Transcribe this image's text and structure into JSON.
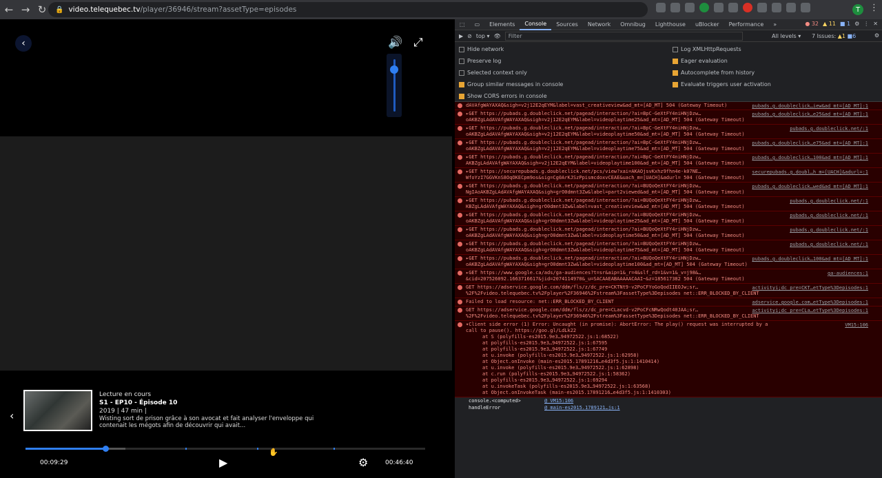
{
  "browser": {
    "url_host": "video.telequebec.tv",
    "url_path": "/player/36946/stream?assetType=episodes",
    "profile_initial": "T"
  },
  "player": {
    "now_playing_label": "Lecture en cours",
    "episode_title": "S1 - EP10 - Épisode 10",
    "episode_meta": "2019 | 47 min |",
    "episode_description": "Wisting sort de prison grâce à son avocat et fait analyser l'enveloppe qui contenait les mégots afin de découvrir qui avait...",
    "current_time": "00:09:29",
    "total_time": "00:46:40",
    "progress": 0.2,
    "buffered": 0.25,
    "volume": 0.8
  },
  "devtools": {
    "tabs": [
      "Elements",
      "Console",
      "Sources",
      "Network",
      "Omnibug",
      "Lighthouse",
      "uBlocker",
      "Performance",
      "»"
    ],
    "active_tab": "Console",
    "counts": {
      "errors": "32",
      "warnings": "11",
      "info": "1"
    },
    "toolbar": {
      "context": "top ▾",
      "filter_placeholder": "Filter",
      "levels": "All levels ▾",
      "issues_label": "7 Issues:",
      "issues_warn": "1",
      "issues_info": "6"
    },
    "settings_left": [
      {
        "label": "Hide network",
        "checked": false
      },
      {
        "label": "Preserve log",
        "checked": false
      },
      {
        "label": "Selected context only",
        "checked": false
      },
      {
        "label": "Group similar messages in console",
        "checked": true
      },
      {
        "label": "Show CORS errors in console",
        "checked": true
      }
    ],
    "settings_right": [
      {
        "label": "Log XMLHttpRequests",
        "checked": false
      },
      {
        "label": "Eager evaluation",
        "checked": true
      },
      {
        "label": "Autocomplete from history",
        "checked": true
      },
      {
        "label": "Evaluate triggers user activation",
        "checked": true
      }
    ],
    "messages": [
      {
        "text": "dAVAfgWAYAXAQ&sigh=v2j12E2qEYM&label=vast_creativeview&ad_mt=[AD_MT] 504 (Gateway Timeout)",
        "src": "pubads.g.doubleclick…iew&ad_mt=[AD_MT]:1"
      },
      {
        "text": "▸GET https://pubads.g.doubleclick.net/pagead/interaction/?ai=BpC-GeXtFY4niHNjDzw…oAKBZgLAdAVAfgWAYAXAQ&sigh=v2j12E2qEYM&label=videoplaytime25&ad_mt=[AD_MT] 504 (Gateway Timeout)",
        "src": "pubads.g.doubleclick…e25&ad_mt=[AD_MT]:1"
      },
      {
        "text": "▸GET https://pubads.g.doubleclick.net/pagead/interaction/?ai=BpC-GeXtFY4niHNjDzw…oAKBZgLAdAVAfgWAYAXAQ&sigh=v2j12E2qEYM&label=videoplaytime50&ad_mt=[AD_MT] 504 (Gateway Timeout)",
        "src": "pubads.g.doubleclick.net/:1"
      },
      {
        "text": "▸GET https://pubads.g.doubleclick.net/pagead/interaction/?ai=BpC-GeXtFY4niHNjDzw…oAKBZgLAdAVAfgWAYAXAQ&sigh=v2j12E2qEYM&label=videoplaytime75&ad_mt=[AD_MT] 504 (Gateway Timeout)",
        "src": "pubads.g.doubleclick…e75&ad_mt=[AD_MT]:1"
      },
      {
        "text": "▸GET https://pubads.g.doubleclick.net/pagead/interaction/?ai=BpC-GeXtFY4niHNjDzw…AKBZgLAdAVAfgWAYAXAQ&sigh=v2j12E2qEYM&label=videoplaytime100&ad_mt=[AD_MT] 504 (Gateway Timeout)",
        "src": "pubads.g.doubleclick…100&ad_mt=[AD_MT]:1"
      },
      {
        "text": "▸GET https://securepubads.g.doubleclick.net/pcs/view?xai=AKAOjsvKxhz9fhn4e-k07NE…WfoYzI7GGVKnS8OqOKECpm9os&sig=Cg0ArKJSzPpismcdoxvCEAE&uach_m=[UACH]&adurl= 504 (Gateway Timeout)",
        "src": "securepubads.g.doubl…h_m=[UACH]&adurl=:1"
      },
      {
        "text": "▸GET https://pubads.g.doubleclick.net/pagead/interaction/?ai=BUQoQeXtFY4riHNjDzw…NgIAoAKBZgLAdAVAfgWAYAXAQ&sigh=grO0dmnt3Zw&label=part2viewed&ad_mt=[AD_MT] 504 (Gateway Timeout)",
        "src": "pubads.g.doubleclick…wed&ad_mt=[AD_MT]:1"
      },
      {
        "text": "▸GET https://pubads.g.doubleclick.net/pagead/interaction/?ai=BUQoQeXtFY4riHNjDzw…KBZgLAdAVAfgWAYAXAQ&sigh=grO0dmnt3Zw&label=vast_creativeview&ad_mt=[AD_MT] 504 (Gateway Timeout)",
        "src": "pubads.g.doubleclick.net/:1"
      },
      {
        "text": "▸GET https://pubads.g.doubleclick.net/pagead/interaction/?ai=BUQoQeXtFY4riHNjDzw…oAKBZgLAdAVAfgWAYAXAQ&sigh=grO0dmnt3Zw&label=videoplaytime25&ad_mt=[AD_MT] 504 (Gateway Timeout)",
        "src": "pubads.g.doubleclick.net/:1"
      },
      {
        "text": "▸GET https://pubads.g.doubleclick.net/pagead/interaction/?ai=BUQoQeXtFY4riHNjDzw…oAKBZgLAdAVAfgWAYAXAQ&sigh=grO0dmnt3Zw&label=videoplaytime50&ad_mt=[AD_MT] 504 (Gateway Timeout)",
        "src": "pubads.g.doubleclick.net/:1"
      },
      {
        "text": "▸GET https://pubads.g.doubleclick.net/pagead/interaction/?ai=BUQoQeXtFY4riHNjDzw…oAKBZgLAdAVAfgWAYAXAQ&sigh=grO0dmnt3Zw&label=videoplaytime75&ad_mt=[AD_MT] 504 (Gateway Timeout)",
        "src": "pubads.g.doubleclick.net/:1"
      },
      {
        "text": "▸GET https://pubads.g.doubleclick.net/pagead/interaction/?ai=BUQoQeXtFY4riHNjDzw…oAKBZgLAdAVAfgWAYAXAQ&sigh=grO0dmnt3Zw&label=videoplaytime100&ad_mt=[AD_MT] 504 (Gateway Timeout)",
        "src": "pubads.g.doubleclick…100&ad_mt=[AD_MT]:1"
      },
      {
        "text": "▸GET https://www.google.ca/ads/ga-audiences?t=sr&aip=1&_r=4&slf_rd=1&v=1&_v=j98&…&cid=207526092.1663716617&jid=2074114970&_u=SACAAEABAAAAACAAI~&z=185617382 504 (Gateway Timeout)",
        "src": "ga-audiences:1"
      },
      {
        "text": "GET https://adservice.google.com/ddm/fls/z/dc_pre=CKTNt9-v2PoCFYoGoQodIIEOJw;sr…%2F%2Fvideo.telequebec.tv%2Fplayer%2F36946%2Fstream%3FassetType%3Depisodes net::ERR_BLOCKED_BY_CLIENT",
        "src": "activityi;dc_pre=CKT…etType%3Depisodes:1"
      },
      {
        "text": "Failed to load resource: net::ERR_BLOCKED_BY_CLIENT",
        "src": "adservice.google.com…etType%3Depisodes:1"
      },
      {
        "text": "GET https://adservice.google.com/ddm/fls/z/dc_pre=CLacvd-v2PoCFcNRwQodt40JAA;sr…%2F%2Fvideo.telequebec.tv%2Fplayer%2F36946%2Fstream%3FassetType%3Depisodes net::ERR_BLOCKED_BY_CLIENT",
        "src": "activityi;dc_pre=CLa…etType%3Depisodes:1"
      },
      {
        "text": "▾Client side error (1) Error: Uncaught (in promise): AbortError: The play() request was interrupted by a call to pause(). https://goo.gl/LdLk22",
        "src": "VM15:106"
      }
    ],
    "stack": [
      "at S (polyfills-es2015.9e3…94972522.js:1:68522)",
      "at polyfills-es2015.9e3…94972522.js:1:67595",
      "at polyfills-es2015.9e3…94972522.js:1:67749",
      "at u.invoke (polyfills-es2015.9e3…94972522.js:1:62958)",
      "at Object.onInvoke (main-es2015.17891216…e4d3f5.js:1:1410414)",
      "at u.invoke (polyfills-es2015.9e3…94972522.js:1:62898)",
      "at c.run (polyfills-es2015.9e3…94972522.js:1:58362)",
      "at polyfills-es2015.9e3…94972522.js:1:69294",
      "at u.invokeTask (polyfills-es2015.9e3…94972522.js:1:63568)",
      "at Object.onInvokeTask (main-es2015.17891216…e4d3f5.js:1:1410303)"
    ],
    "footer": [
      {
        "name": "console.<computed>",
        "src": "@ VM15:106"
      },
      {
        "name": "handleError",
        "src": "@ main-es2015.1789121…js:1"
      }
    ]
  }
}
